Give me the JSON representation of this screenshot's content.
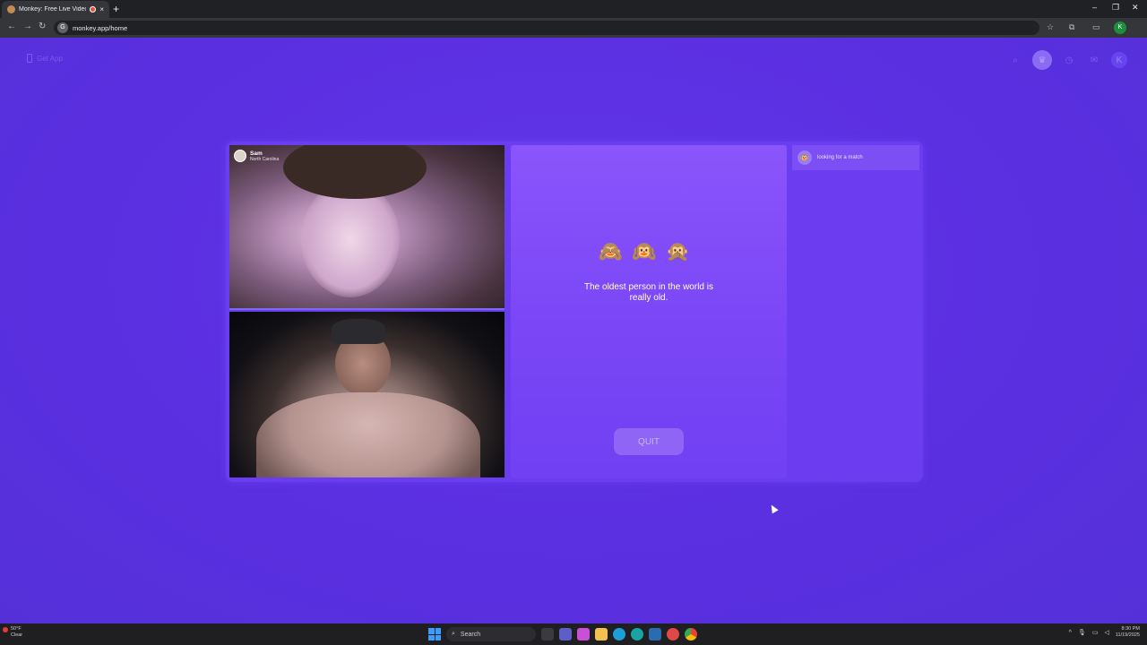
{
  "browser": {
    "tab_title": "Monkey: Free Live Video Ch",
    "tab_close": "×",
    "new_tab": "+",
    "url": "monkey.app/home",
    "profile_initial": "K",
    "window_controls": [
      "–",
      "❐",
      "✕"
    ]
  },
  "header": {
    "get_app_label": "Get App",
    "avatar_initial": "K",
    "icons": [
      "search-icon",
      "crown-icon",
      "history-icon",
      "chat-icon",
      "profile-icon"
    ]
  },
  "chat": {
    "partner": {
      "name": "Sam",
      "location": "North Carolina"
    },
    "emojis": "🙈🙉🙊",
    "fact_text": "The oldest person in the world is really old.",
    "quit_label": "QUIT",
    "side_status": "looking for a match"
  },
  "taskbar": {
    "weather_temp": "50°F",
    "weather_desc": "Clear",
    "search_placeholder": "Search",
    "time": "8:30 PM",
    "date": "11/19/2025"
  },
  "colors": {
    "page_bg": "#5a2fe0",
    "panel_bg": "#8a55fb",
    "quit_bg": "#8f65f6"
  }
}
